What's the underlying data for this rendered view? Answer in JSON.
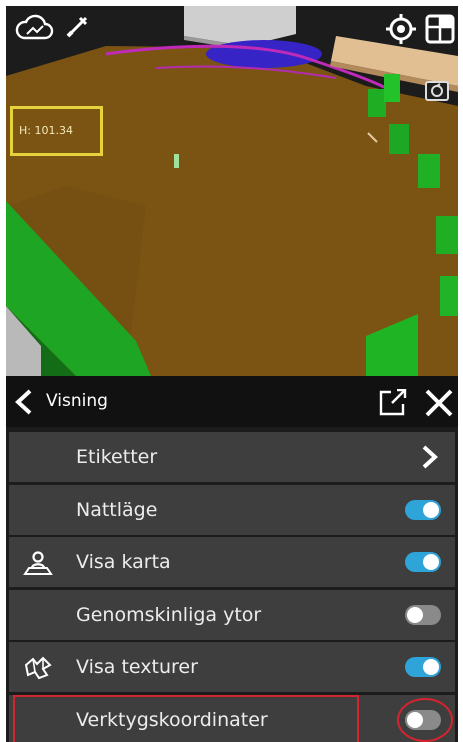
{
  "viewport": {
    "height_readout": "H: 101.34",
    "icons": {
      "cloud": "cloud-icon",
      "tool": "crossed-tool-icon",
      "locate": "locate-crosshair-icon",
      "layers": "layers-icon",
      "camera": "camera-rotate-icon"
    }
  },
  "panel": {
    "title": "Visning",
    "rows": [
      {
        "label": "Etiketter",
        "control": "chevron"
      },
      {
        "label": "Nattläge",
        "control": "toggle",
        "on": true
      },
      {
        "label": "Visa karta",
        "control": "toggle",
        "on": true,
        "icon": "map-person-icon"
      },
      {
        "label": "Genomskinliga ytor",
        "control": "toggle",
        "on": false
      },
      {
        "label": "Visa texturer",
        "control": "toggle",
        "on": true,
        "icon": "texture-icon"
      },
      {
        "label": "Verktygskoordinater",
        "control": "toggle",
        "on": false
      }
    ]
  },
  "colors": {
    "toggle_on": "#2ea4d8",
    "toggle_off": "#8a8a8a",
    "highlight": "#d4242f",
    "readout_border": "#e6d23c"
  }
}
